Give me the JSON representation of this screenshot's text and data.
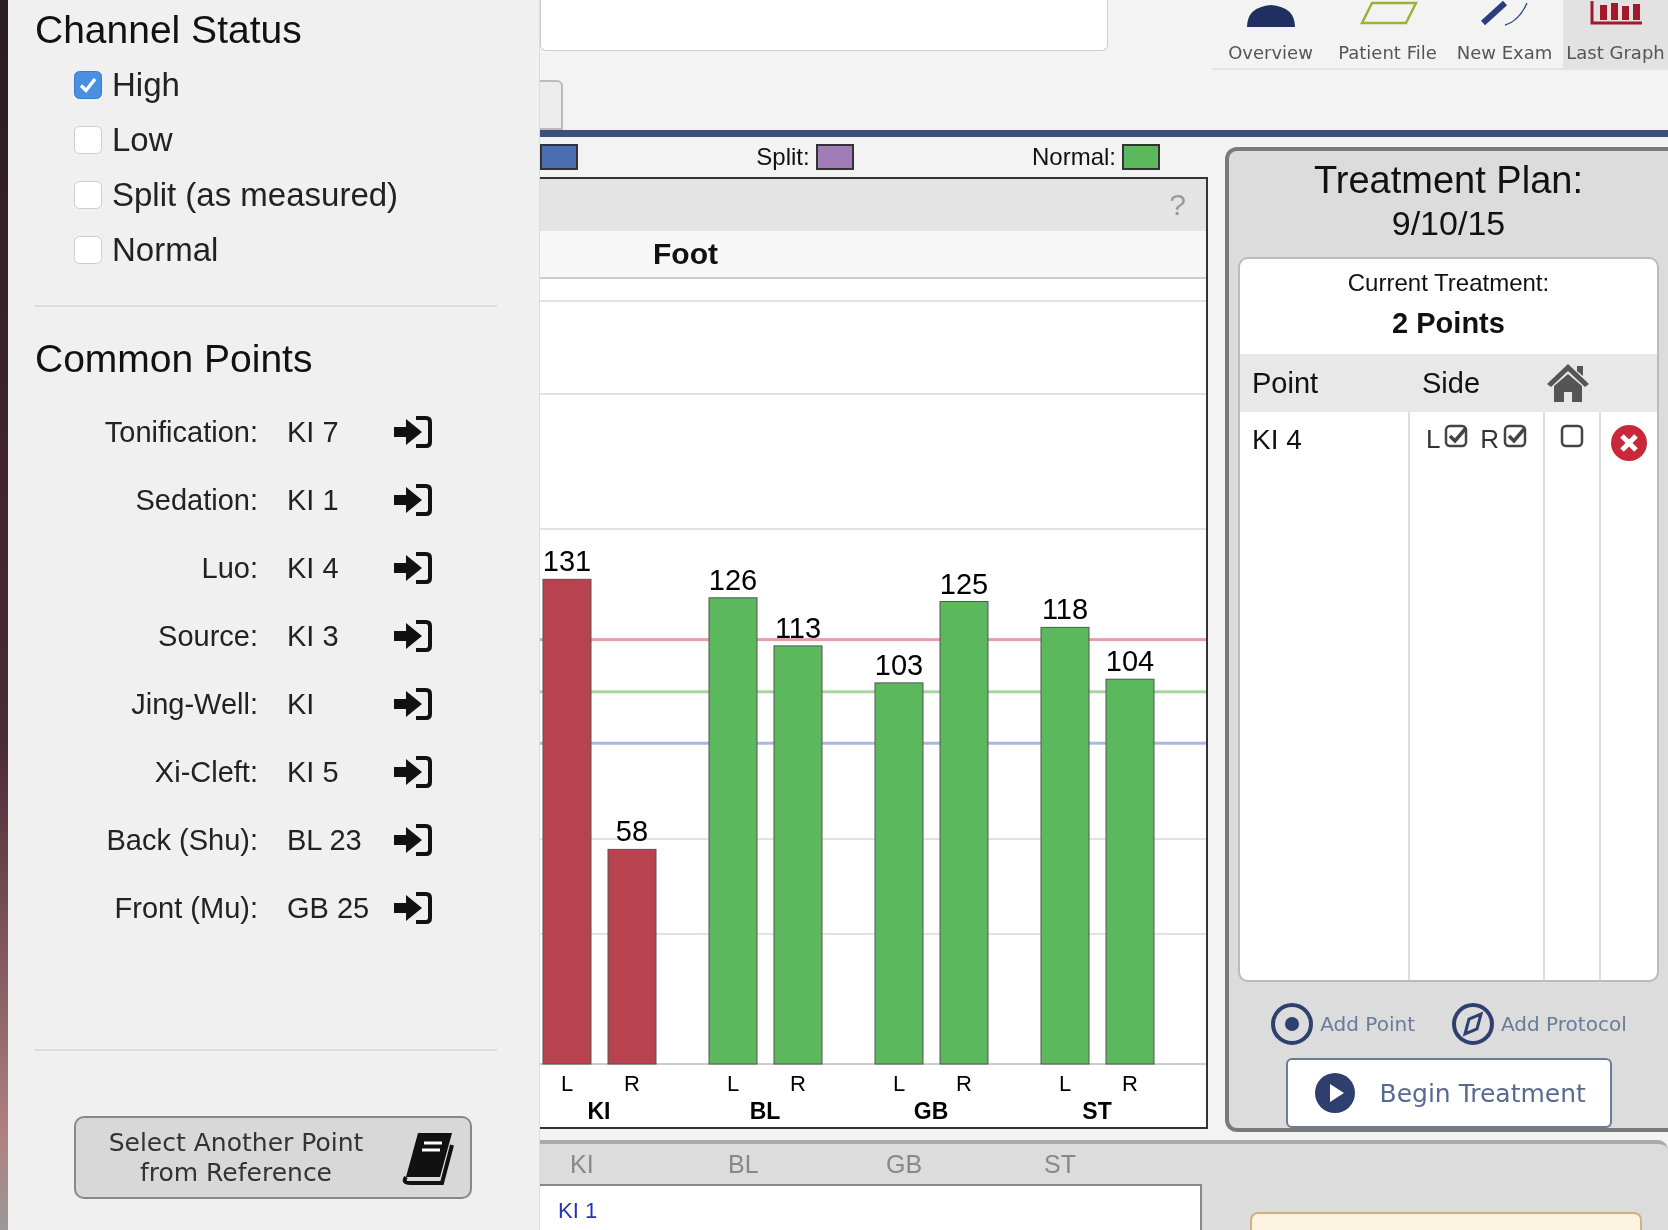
{
  "channel_status": {
    "title": "Channel Status",
    "options": [
      {
        "label": "High",
        "checked": true
      },
      {
        "label": "Low",
        "checked": false
      },
      {
        "label": "Split (as measured)",
        "checked": false
      },
      {
        "label": "Normal",
        "checked": false
      }
    ]
  },
  "common_points": {
    "title": "Common Points",
    "rows": [
      {
        "label": "Tonification:",
        "point": "KI 7"
      },
      {
        "label": "Sedation:",
        "point": "KI 1"
      },
      {
        "label": "Luo:",
        "point": "KI 4"
      },
      {
        "label": "Source:",
        "point": "KI 3"
      },
      {
        "label": "Jing-Well:",
        "point": "KI"
      },
      {
        "label": "Xi-Cleft:",
        "point": "KI 5"
      },
      {
        "label": "Back (Shu):",
        "point": "BL 23"
      },
      {
        "label": "Front (Mu):",
        "point": "GB 25"
      }
    ]
  },
  "reference_button": {
    "label": "Select Another Point from Reference"
  },
  "toolbar": [
    {
      "label": "Overview",
      "kind": "person",
      "selected": false
    },
    {
      "label": "Patient File",
      "kind": "folder",
      "selected": false
    },
    {
      "label": "New Exam",
      "kind": "pen",
      "selected": false
    },
    {
      "label": "Last Graph",
      "kind": "graph",
      "selected": true
    }
  ],
  "legend": [
    {
      "color": "#4a6fb0"
    },
    {
      "label": "Split:",
      "color": "#a27cb9"
    },
    {
      "label": "Normal:",
      "color": "#5cb85c"
    }
  ],
  "chart": {
    "help": "?",
    "title": "Foot",
    "chart_data": {
      "type": "bar",
      "categories": [
        "KI",
        "BL",
        "GB",
        "ST"
      ],
      "series": [
        {
          "name": "L",
          "colors": [
            "#b8424d",
            "#5cb85c",
            "#5cb85c",
            "#5cb85c"
          ],
          "values": [
            131,
            126,
            103,
            118
          ]
        },
        {
          "name": "R",
          "colors": [
            "#b8424d",
            "#5cb85c",
            "#5cb85c",
            "#5cb85c"
          ],
          "values": [
            58,
            113,
            125,
            104
          ]
        }
      ],
      "data_labels": true
    }
  },
  "treatment_plan": {
    "title": "Treatment Plan:",
    "date": "9/10/15",
    "current_label": "Current Treatment:",
    "count": "2 Points",
    "columns": [
      "Point",
      "Side"
    ],
    "rows": [
      {
        "point": "KI 4",
        "left_label": "L",
        "left": true,
        "right_label": "R",
        "right": true,
        "home": false
      }
    ],
    "actions": [
      {
        "label": "Add Point",
        "kind": "point"
      },
      {
        "label": "Add Protocol",
        "kind": "protocol"
      }
    ],
    "begin_button": "Begin Treatment"
  },
  "bottom_tabs": [
    "KI",
    "BL",
    "GB",
    "ST"
  ],
  "bottom_list": [
    "KI 1"
  ]
}
